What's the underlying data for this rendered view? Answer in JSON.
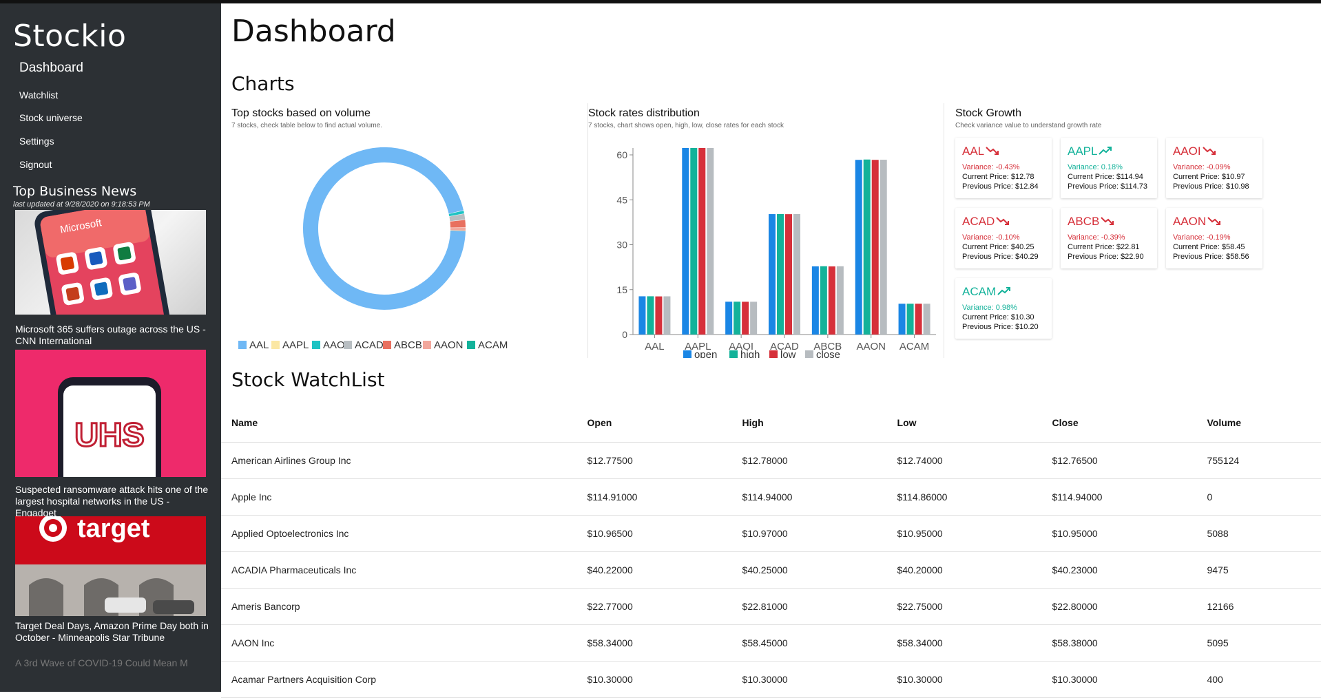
{
  "sidebar": {
    "brand": "Stockio",
    "nav": [
      "Dashboard",
      "Watchlist",
      "Stock universe",
      "Settings",
      "Signout"
    ],
    "news_title": "Top Business News",
    "news_updated": "last updated at 9/28/2020 on 9:18:53 PM",
    "news": [
      {
        "caption": "Microsoft 365 suffers outage across the US - CNN International",
        "image_text": "Microsoft"
      },
      {
        "caption": "Suspected ransomware attack hits one of the largest hospital networks in the US - Engadget",
        "image_text": "UHS"
      },
      {
        "caption": "Target Deal Days, Amazon Prime Day both in October - Minneapolis Star Tribune",
        "image_text": "target"
      }
    ],
    "news_more": "A 3rd Wave of COVID-19 Could Mean M"
  },
  "main": {
    "title": "Dashboard",
    "charts_title": "Charts",
    "watchlist_title": "Stock WatchList"
  },
  "colors": {
    "open": "#1a86e5",
    "high": "#13b29a",
    "low": "#d6303a",
    "close": "#b7bcc0",
    "down": "#d6303a",
    "up": "#13b29a"
  },
  "chart_data": [
    {
      "type": "pie",
      "title": "Top stocks based on volume",
      "subtitle": "7 stocks, check table below to find actual volume.",
      "categories": [
        "AAL",
        "AAPL",
        "AAOI",
        "ACAD",
        "ABCB",
        "AAON",
        "ACAM"
      ],
      "values": [
        755124,
        0,
        5088,
        9475,
        12166,
        5095,
        400
      ],
      "colors": [
        "#6fb8f5",
        "#fbe7a4",
        "#1ec3c3",
        "#b8bec2",
        "#e8705f",
        "#f2a79c",
        "#13b29a"
      ],
      "legend": "bottom",
      "donut": true
    },
    {
      "type": "bar",
      "title": "Stock rates distribution",
      "subtitle": "7 stocks, chart shows open, high, low, close rates for each stock",
      "categories": [
        "AAL",
        "AAPL",
        "AAOI",
        "ACAD",
        "ABCB",
        "AAON",
        "ACAM"
      ],
      "series": [
        {
          "name": "open",
          "values": [
            12.775,
            114.91,
            10.965,
            40.22,
            22.77,
            58.34,
            10.3
          ]
        },
        {
          "name": "high",
          "values": [
            12.78,
            114.94,
            10.97,
            40.25,
            22.81,
            58.45,
            10.3
          ]
        },
        {
          "name": "low",
          "values": [
            12.74,
            114.86,
            10.95,
            40.2,
            22.75,
            58.34,
            10.3
          ]
        },
        {
          "name": "close",
          "values": [
            12.765,
            114.94,
            10.95,
            40.23,
            22.8,
            58.38,
            10.3
          ]
        }
      ],
      "yticks": [
        0,
        15,
        30,
        45,
        60
      ],
      "ylim": [
        0,
        60
      ],
      "legend": "bottom",
      "grid": false
    }
  ],
  "growth": {
    "title": "Stock Growth",
    "subtitle": "Check variance value to understand growth rate",
    "cards": [
      {
        "symbol": "AAL",
        "variance": "Variance: -0.43%",
        "current": "Current Price: $12.78",
        "previous": "Previous Price: $12.84",
        "trend": "down"
      },
      {
        "symbol": "AAPL",
        "variance": "Variance: 0.18%",
        "current": "Current Price: $114.94",
        "previous": "Previous Price: $114.73",
        "trend": "up"
      },
      {
        "symbol": "AAOI",
        "variance": "Variance: -0.09%",
        "current": "Current Price: $10.97",
        "previous": "Previous Price: $10.98",
        "trend": "down"
      },
      {
        "symbol": "ACAD",
        "variance": "Variance: -0.10%",
        "current": "Current Price: $40.25",
        "previous": "Previous Price: $40.29",
        "trend": "down"
      },
      {
        "symbol": "ABCB",
        "variance": "Variance: -0.39%",
        "current": "Current Price: $22.81",
        "previous": "Previous Price: $22.90",
        "trend": "down"
      },
      {
        "symbol": "AAON",
        "variance": "Variance: -0.19%",
        "current": "Current Price: $58.45",
        "previous": "Previous Price: $58.56",
        "trend": "down"
      },
      {
        "symbol": "ACAM",
        "variance": "Variance: 0.98%",
        "current": "Current Price: $10.30",
        "previous": "Previous Price: $10.20",
        "trend": "up"
      }
    ]
  },
  "table": {
    "headers": [
      "Name",
      "Open",
      "High",
      "Low",
      "Close",
      "Volume"
    ],
    "rows": [
      [
        "American Airlines Group Inc",
        "$12.77500",
        "$12.78000",
        "$12.74000",
        "$12.76500",
        "755124"
      ],
      [
        "Apple Inc",
        "$114.91000",
        "$114.94000",
        "$114.86000",
        "$114.94000",
        "0"
      ],
      [
        "Applied Optoelectronics Inc",
        "$10.96500",
        "$10.97000",
        "$10.95000",
        "$10.95000",
        "5088"
      ],
      [
        "ACADIA Pharmaceuticals Inc",
        "$40.22000",
        "$40.25000",
        "$40.20000",
        "$40.23000",
        "9475"
      ],
      [
        "Ameris Bancorp",
        "$22.77000",
        "$22.81000",
        "$22.75000",
        "$22.80000",
        "12166"
      ],
      [
        "AAON Inc",
        "$58.34000",
        "$58.45000",
        "$58.34000",
        "$58.38000",
        "5095"
      ],
      [
        "Acamar Partners Acquisition Corp",
        "$10.30000",
        "$10.30000",
        "$10.30000",
        "$10.30000",
        "400"
      ]
    ]
  }
}
